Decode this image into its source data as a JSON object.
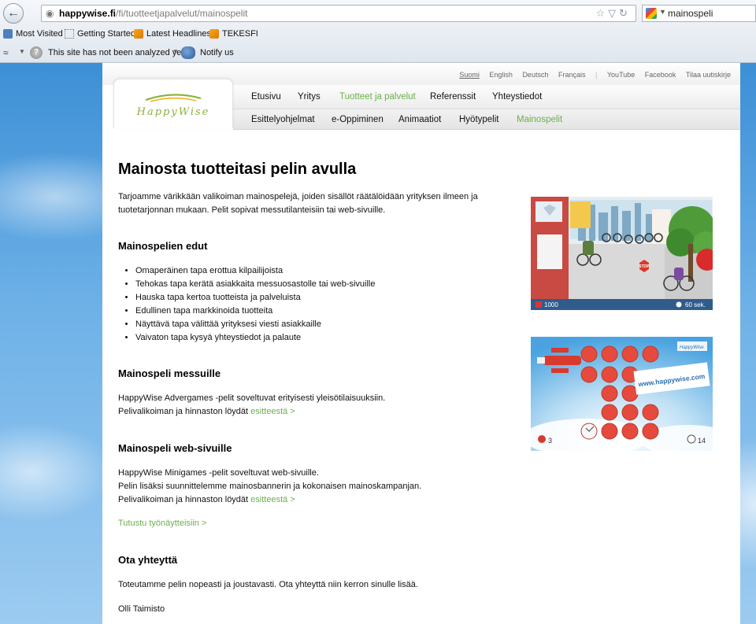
{
  "browser": {
    "url_host": "happywise.fi",
    "url_path": "/fi/tuotteetjapalvelut/mainospelit",
    "search_value": "mainospeli",
    "bookmarks": [
      "Most Visited",
      "Getting Started",
      "Latest Headlines",
      "TEKESFI"
    ],
    "wot_text": "This site has not been analyzed yet",
    "notify_label": "Notify us"
  },
  "site": {
    "top_links": [
      "Suomi",
      "English",
      "Deutsch",
      "Français",
      "YouTube",
      "Facebook",
      "Tilaa uutiskirje"
    ],
    "logo_text": "HappyWise",
    "main_nav": [
      "Etusivu",
      "Yritys",
      "Tuotteet ja palvelut",
      "Referenssit",
      "Yhteystiedot"
    ],
    "sub_nav": [
      "Esittelyohjelmat",
      "e-Oppiminen",
      "Animaatiot",
      "Hyötypelit",
      "Mainospelit"
    ]
  },
  "content": {
    "title": "Mainosta tuotteitasi pelin avulla",
    "intro_line1": "Tarjoamme värikkään valikoiman mainospelejä, joiden sisällöt räätälöidään yrityksen ilmeen ja",
    "intro_line2": "tuotetarjonnan mukaan. Pelit sopivat messutilanteisiin tai web-sivuille.",
    "benefits_heading": "Mainospelien edut",
    "benefits": [
      "Omaperäinen tapa erottua kilpailijoista",
      "Tehokas tapa kerätä asiakkaita messuosastolle tai web-sivuille",
      "Hauska tapa kertoa tuotteista ja palveluista",
      "Edullinen tapa markkinoida tuotteita",
      "Näyttävä tapa välittää yrityksesi viesti asiakkaille",
      "Vaivaton tapa kysyä yhteystiedot ja palaute"
    ],
    "fair_heading": "Mainospeli messuille",
    "fair_line1": "HappyWise Advergames -pelit soveltuvat erityisesti yleisötilaisuuksiin.",
    "fair_line2": "Pelivalikoiman ja hinnaston löydät",
    "fair_link": "esitteestä >",
    "web_heading": "Mainospeli web-sivuille",
    "web_line1": "HappyWise Minigames -pelit soveltuvat web-sivuille.",
    "web_line2": "Pelin lisäksi suunnittelemme mainosbannerin ja kokonaisen mainoskampanjan.",
    "web_line3": "Pelivalikoiman ja hinnaston löydät",
    "web_link": "esitteestä >",
    "samples_link": "Tutustu työnäytteisiin >",
    "contact_heading": "Ota yhteyttä",
    "contact_text": "Toteutamme pelin nopeasti ja joustavasti. Ota yhteyttä niin kerron sinulle lisää.",
    "contact_name": "Olli Taimisto"
  },
  "games": {
    "game1_score": "1000",
    "game1_time": "60 sek.",
    "game1_sign": "STOP",
    "game2_url": "www.happywise.com",
    "game2_badge": "HappyWise",
    "game2_left_count": "3",
    "game2_right_count": "14"
  }
}
